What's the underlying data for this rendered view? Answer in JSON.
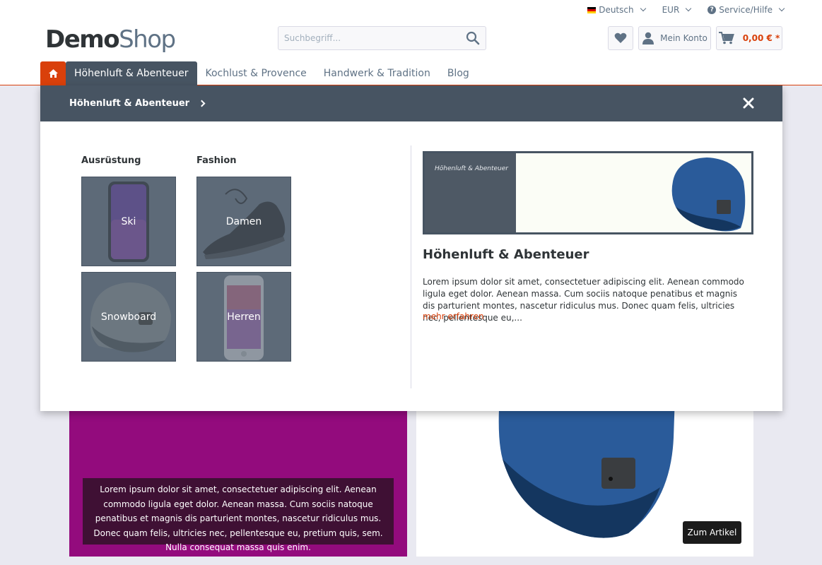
{
  "topbar": {
    "language": "Deutsch",
    "currency": "EUR",
    "service": "Service/Hilfe"
  },
  "logo": {
    "bold": "Demo",
    "light": "Shop"
  },
  "search": {
    "placeholder": "Suchbegriff..."
  },
  "header": {
    "account_label": "Mein Konto",
    "cart_total": "0,00 € *"
  },
  "nav": {
    "items": [
      {
        "label": "Höhenluft & Abenteuer",
        "active": true
      },
      {
        "label": "Kochlust & Provence"
      },
      {
        "label": "Handwerk & Tradition"
      },
      {
        "label": "Blog"
      }
    ]
  },
  "flyout": {
    "title": "Höhenluft & Abenteuer",
    "columns": [
      {
        "title": "Ausrüstung",
        "tiles": [
          "Ski",
          "Snowboard"
        ]
      },
      {
        "title": "Fashion",
        "tiles": [
          "Damen",
          "Herren"
        ]
      }
    ],
    "teaser_label": "Höhenluft & Abenteuer",
    "category_title": "Höhenluft & Abenteuer",
    "category_text": "Lorem ipsum dolor sit amet, consectetuer adipiscing elit. Aenean commodo ligula eget dolor. Aenean massa. Cum sociis natoque penatibus et magnis dis parturient montes, nascetur ridiculus mus. Donec quam felis, ultricies nec, pellentesque eu,...",
    "more_link": "mehr erfahren"
  },
  "background": {
    "text": "Lorem ipsum dolor sit amet, consectetuer adipiscing elit. Aenean commodo ligula eget dolor. Aenean massa. Cum sociis natoque penatibus et magnis dis parturient montes, nascetur ridiculus mus. Donec quam felis, ultricies nec, pellentesque eu, pretium quis, sem. Nulla consequat massa quis enim.",
    "button": "Zum Artikel"
  },
  "colors": {
    "accent": "#d9400b",
    "nav_active": "#475462",
    "magenta": "#930b7d"
  }
}
